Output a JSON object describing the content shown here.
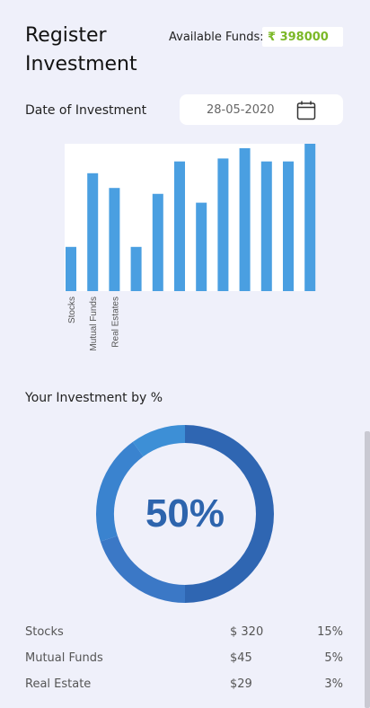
{
  "header": {
    "title_line1": "Register",
    "title_line2": "Investment",
    "funds_label": "Available Funds:",
    "funds_value": "₹ 398000"
  },
  "date": {
    "label": "Date of Investment",
    "value": "28-05-2020",
    "icon": "calendar-icon"
  },
  "chart_data": [
    {
      "type": "bar",
      "categories": [
        "Stocks",
        "Mutual Funds",
        "Real Estates",
        "",
        "",
        "",
        "",
        "",
        "",
        "",
        "",
        ""
      ],
      "values": [
        30,
        80,
        70,
        30,
        66,
        88,
        60,
        90,
        97,
        88,
        88,
        100
      ],
      "color": "#4a9fe1",
      "ylim": [
        0,
        100
      ],
      "grid": false
    },
    {
      "type": "pie",
      "title": "Your Investment by %",
      "center_label": "50%",
      "values": [
        50,
        20,
        20,
        10
      ],
      "colors": [
        "#2f66b2",
        "#3b78c6",
        "#3a83cf",
        "#3d8fd6"
      ]
    }
  ],
  "investments": [
    {
      "name": "Stocks",
      "amount": "$ 320",
      "percent": "15%"
    },
    {
      "name": "Mutual Funds",
      "amount": "$45",
      "percent": "5%"
    },
    {
      "name": "Real Estate",
      "amount": "$29",
      "percent": "3%"
    }
  ]
}
